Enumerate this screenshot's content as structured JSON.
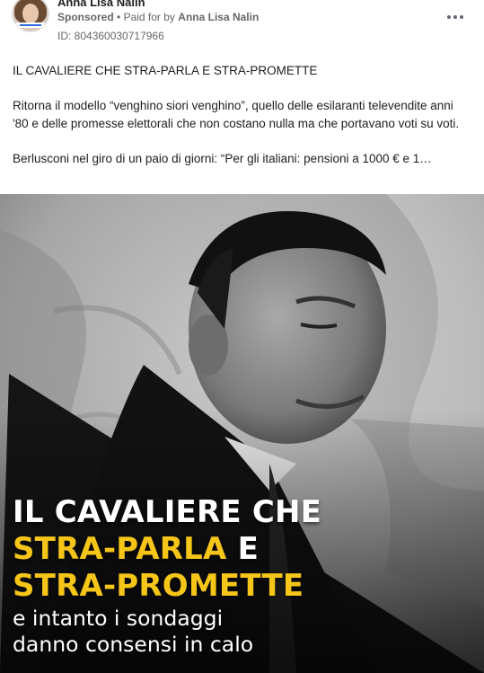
{
  "advertiser": {
    "name": "Anna Lisa Nalin",
    "sponsored_label": "Sponsored",
    "separator": "•",
    "paid_for_label": "Paid for by",
    "paid_for_name": "Anna Lisa Nalin",
    "ad_id": "ID: 804360030717966"
  },
  "post": {
    "paragraphs": [
      "IL CAVALIERE CHE STRA-PARLA E STRA-PROMETTE",
      "Ritorna il modello “venghino siori venghino”, quello delle esilaranti televendite anni '80 e delle promesse elettorali che non costano nulla ma che portavano voti su voti.",
      "Berlusconi nel giro di un paio di giorni: “Per gli italiani: pensioni a 1000 € e 1…"
    ]
  },
  "creative": {
    "headline_line1": "IL CAVALIERE CHE",
    "headline_line2_yellow": "STRA-PARLA",
    "headline_line2_white": "E",
    "headline_line3": "STRA-PROMETTE",
    "subline1": "e intanto i sondaggi",
    "subline2": "danno consensi in calo",
    "colors": {
      "accent_yellow": "#f5c518",
      "text_white": "#ffffff"
    }
  },
  "icons": {
    "more": "more-options-icon"
  }
}
